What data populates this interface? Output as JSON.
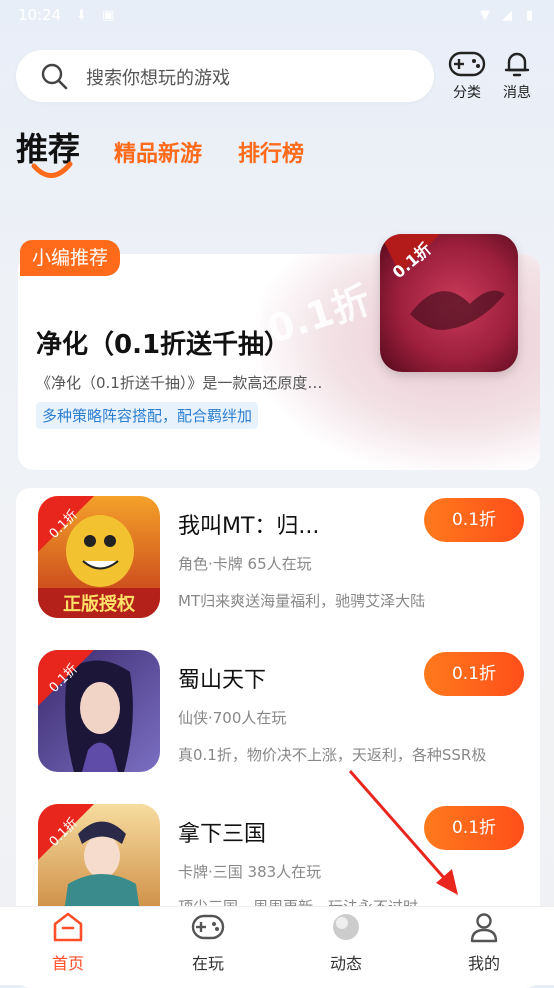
{
  "status_bar": {
    "time": "10:24"
  },
  "search": {
    "placeholder": "搜索你想玩的游戏"
  },
  "header_actions": [
    {
      "label": "分类",
      "icon": "gamepad-icon"
    },
    {
      "label": "消息",
      "icon": "bell-icon"
    }
  ],
  "tabs": [
    {
      "label": "推荐",
      "active": true
    },
    {
      "label": "精品新游",
      "active": false
    },
    {
      "label": "排行榜",
      "active": false
    }
  ],
  "featured": {
    "badge": "小编推荐",
    "title": "净化（0.1折送千抽）",
    "description": "《净化（0.1折送千抽）》是一款高还原度…",
    "tag": "多种策略阵容搭配，配合羁绊加",
    "icon_badge": "0.1折",
    "watermark": "0.1折"
  },
  "games": [
    {
      "title": "我叫MT：归...",
      "meta": "角色·卡牌  65人在玩",
      "desc": "MT归来爽送海量福利，驰骋艾泽大陆",
      "button": "0.1折",
      "corner_badge": "0.1折",
      "icon_text": "正版授权"
    },
    {
      "title": "蜀山天下",
      "meta": "仙侠·700人在玩",
      "desc": "真0.1折，物价决不上涨，天返利，各种SSR极",
      "button": "0.1折",
      "corner_badge": "0.1折"
    },
    {
      "title": "拿下三国",
      "meta": "卡牌·三国  383人在玩",
      "desc": "顶尖三国，周周更新，玩法永不过时",
      "button": "0.1折",
      "corner_badge": "0.1折"
    }
  ],
  "bottom_nav": [
    {
      "label": "首页",
      "icon": "home-icon",
      "active": true
    },
    {
      "label": "在玩",
      "icon": "gamepad-icon",
      "active": false
    },
    {
      "label": "动态",
      "icon": "planet-icon",
      "active": false
    },
    {
      "label": "我的",
      "icon": "profile-icon",
      "active": false
    }
  ],
  "colors": {
    "accent": "#ff6b1a",
    "active_nav": "#ff4e2a",
    "tag_blue": "#2d7fd1"
  }
}
